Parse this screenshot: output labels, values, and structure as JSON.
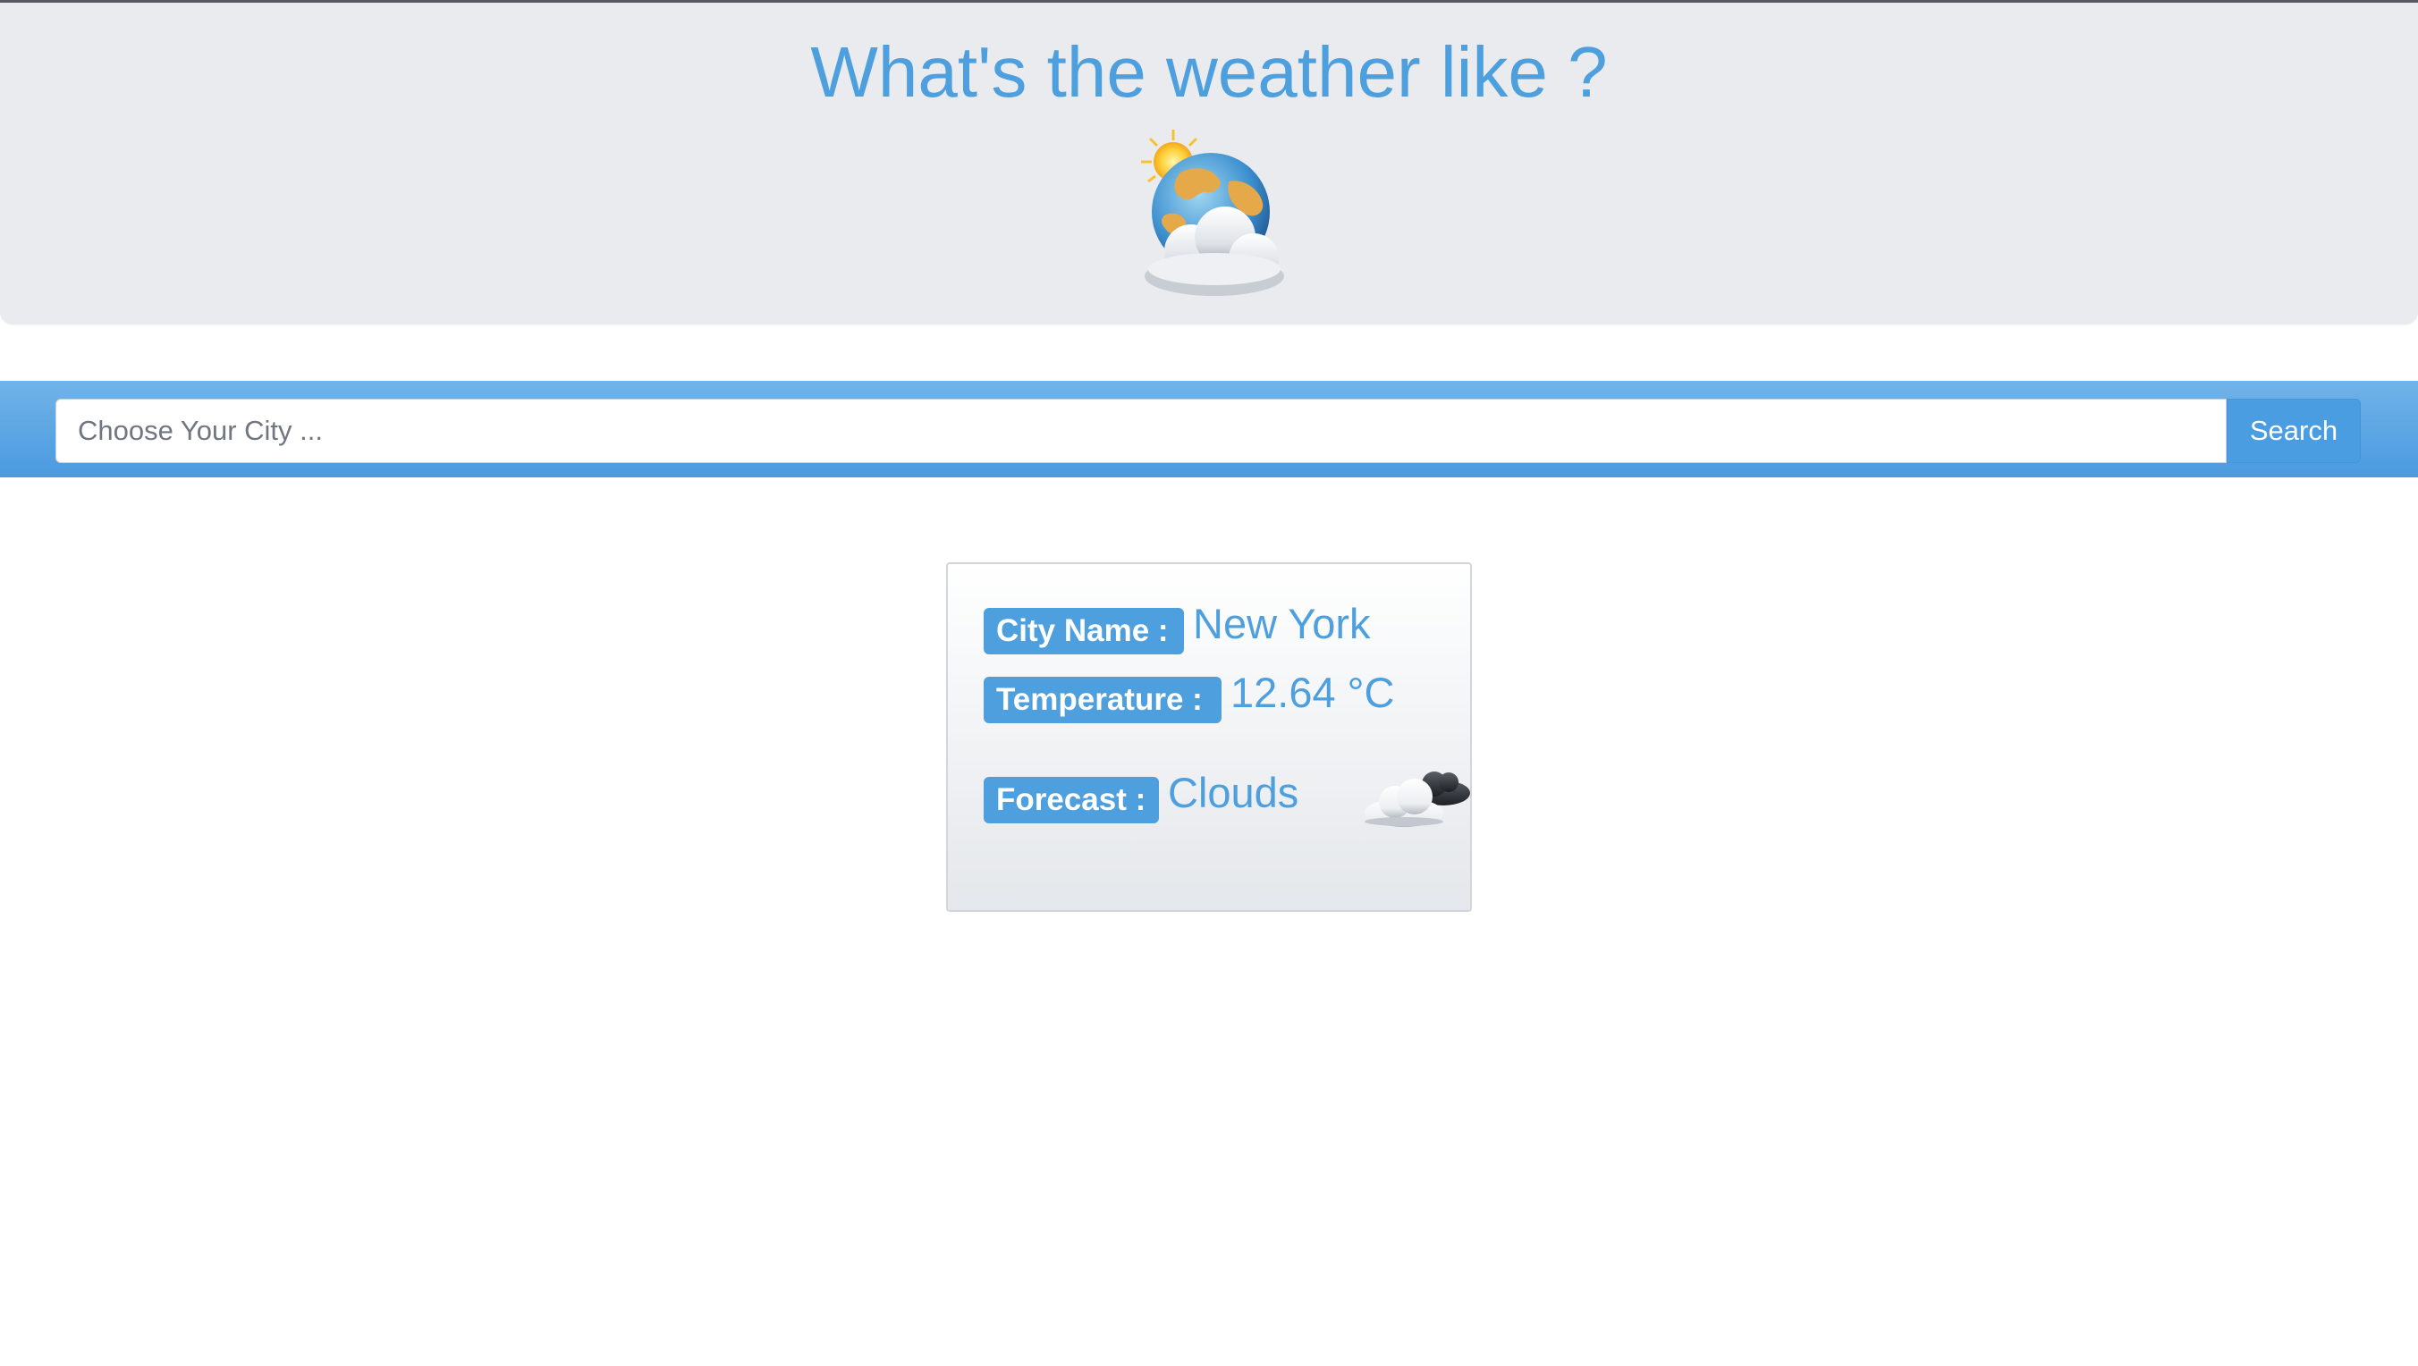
{
  "header": {
    "title": "What's the weather like ?",
    "hero_icon": "globe-sun-clouds-icon"
  },
  "search": {
    "placeholder": "Choose Your City ...",
    "value": "",
    "button_label": "Search"
  },
  "result": {
    "city_label": "City Name :",
    "city_value": "New York",
    "temperature_label": "Temperature :",
    "temperature_value": "12.64 °C",
    "forecast_label": "Forecast :",
    "forecast_value": "Clouds",
    "forecast_icon": "clouds-icon"
  },
  "colors": {
    "accent": "#4e9fdd",
    "header_bg": "#e9ebef",
    "search_band": "#4a9ae0"
  }
}
